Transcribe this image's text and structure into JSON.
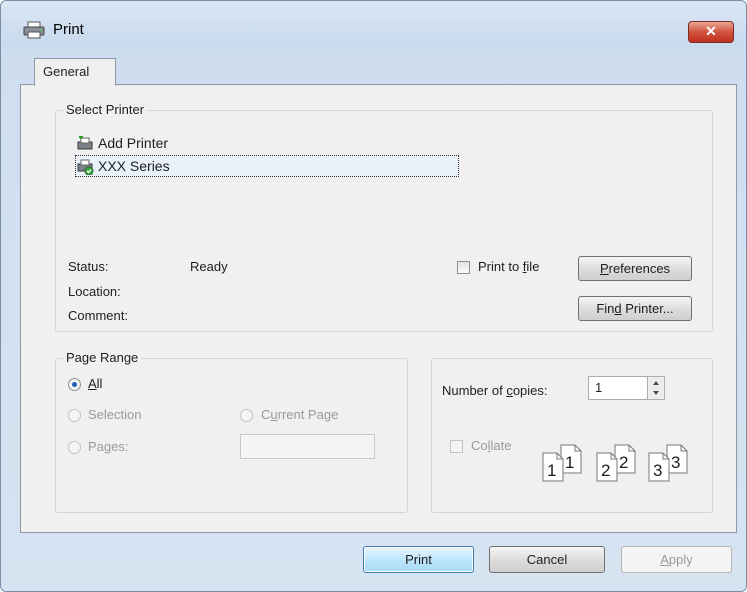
{
  "window": {
    "title": "Print",
    "close_symbol": "✕",
    "icon": "printer-icon"
  },
  "tab": {
    "label": "General"
  },
  "select_printer": {
    "group_label": "Select Printer",
    "items": [
      {
        "label": "Add Printer",
        "icon": "add-printer-icon"
      },
      {
        "label": "XXX Series",
        "icon": "printer-default-icon",
        "selected": true
      }
    ],
    "status_label": "Status:",
    "status_value": "Ready",
    "location_label": "Location:",
    "location_value": "",
    "comment_label": "Comment:",
    "comment_value": "",
    "print_to_file": {
      "pre": "Print to ",
      "key": "f",
      "post": "ile",
      "checked": false
    },
    "preferences": {
      "key": "P",
      "post": "references"
    },
    "find_printer": {
      "pre": "Fin",
      "key": "d",
      "post": " Printer..."
    }
  },
  "page_range": {
    "group_label": "Page Range",
    "all": {
      "key": "A",
      "post": "ll",
      "checked": true
    },
    "selection": {
      "label": "Selection",
      "enabled": false
    },
    "current_page": {
      "pre": "C",
      "key": "u",
      "post": "rrent Page",
      "enabled": false
    },
    "pages": {
      "pre": "Pa",
      "key": "g",
      "post": "es:",
      "enabled": false,
      "value": ""
    }
  },
  "copies": {
    "label_pre": "Number of ",
    "label_key": "c",
    "label_post": "opies:",
    "value": "1",
    "collate": {
      "pre": "Co",
      "key": "l",
      "post": "late",
      "checked": false,
      "enabled": false
    },
    "collate_sets": [
      "1",
      "1",
      "2",
      "2",
      "3",
      "3"
    ]
  },
  "buttons": {
    "print": "Print",
    "cancel": "Cancel",
    "apply_key": "A",
    "apply_post": "pply"
  }
}
